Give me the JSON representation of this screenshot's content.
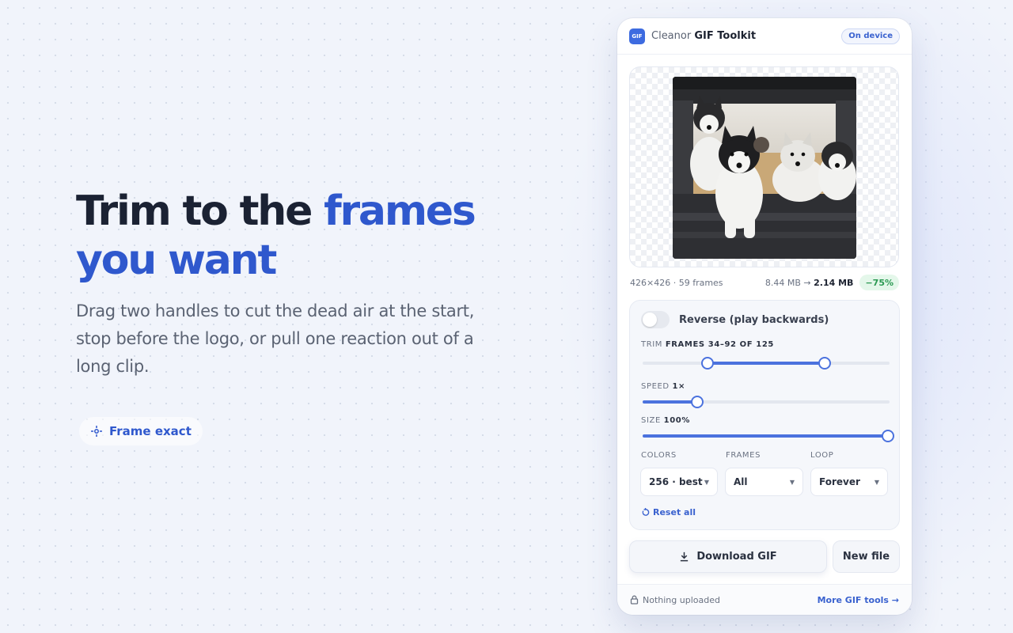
{
  "hero": {
    "title_line1": "Trim to the",
    "title_accent1": "frames",
    "title_accent2": "you want",
    "description": "Drag two handles to cut the dead air at the start, stop before the logo, or pull one reaction out of a long clip.",
    "feature_pill": "Frame exact",
    "feature_icon": "crosshair-icon"
  },
  "app": {
    "logo_text": "GIF",
    "brand": "Cleanor",
    "product": "GIF Toolkit",
    "badge": "On device",
    "accent": "#3d6be0"
  },
  "preview": {
    "info": "426×426 · 59 frames",
    "size_before": "8.44 MB →",
    "size_after": "2.14 MB",
    "saving": "−75%"
  },
  "controls": {
    "reverse": {
      "label": "Reverse (play backwards)",
      "on": false
    },
    "trim": {
      "label": "Trim",
      "value": "FRAMES 34–92 OF 125",
      "start_fraction": 0.264,
      "end_fraction": 0.736
    },
    "speed": {
      "label": "Speed",
      "value": "1×",
      "fraction": 0.22
    },
    "size": {
      "label": "Size",
      "value": "100%",
      "fraction": 1.0
    },
    "colors": {
      "label": "Colors",
      "selected": "256 · best"
    },
    "frames": {
      "label": "Frames",
      "selected": "All"
    },
    "loop": {
      "label": "Loop",
      "selected": "Forever"
    },
    "reset_label": "Reset all"
  },
  "actions": {
    "download": "Download GIF",
    "new_file": "New file"
  },
  "footer": {
    "privacy": "Nothing uploaded",
    "more_tools": "More GIF tools →"
  }
}
